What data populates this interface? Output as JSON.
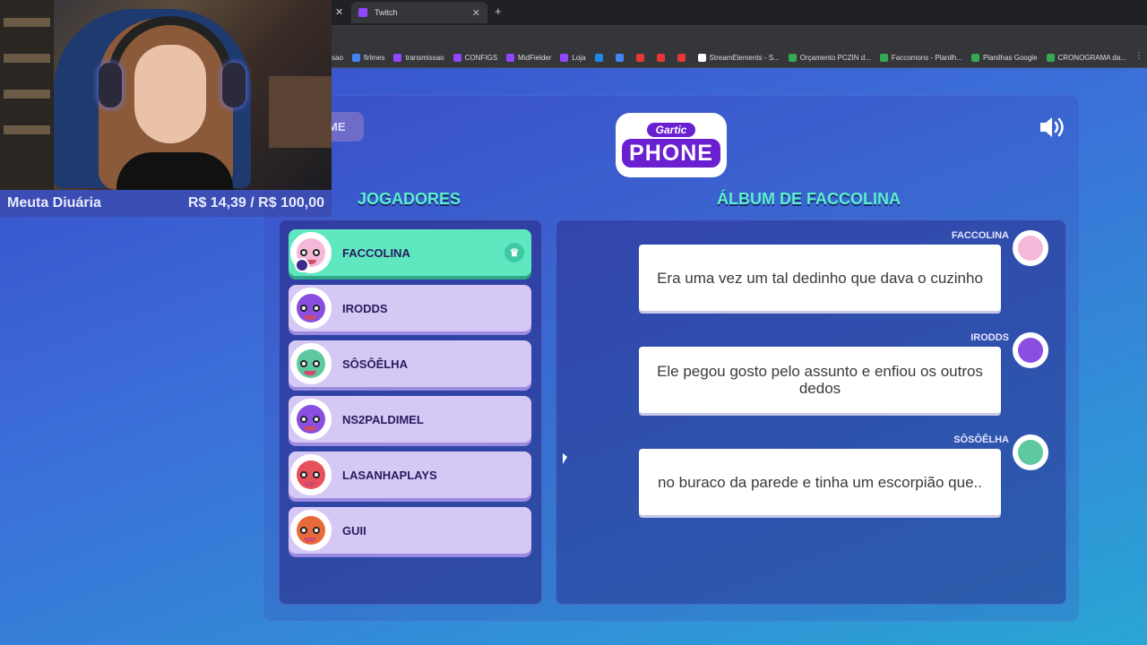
{
  "browser": {
    "active_tab": "Twitch",
    "bookmarks": [
      {
        "label": "sao",
        "color": ""
      },
      {
        "label": "firlmes",
        "color": "#4285f4"
      },
      {
        "label": "transmissao",
        "color": "#9146ff"
      },
      {
        "label": "CONFIGS",
        "color": "#9146ff"
      },
      {
        "label": "MidFielder",
        "color": "#9146ff"
      },
      {
        "label": "Loja",
        "color": "#9146ff"
      },
      {
        "label": "",
        "color": "#1e88e5"
      },
      {
        "label": "",
        "color": "#4285f4"
      },
      {
        "label": "",
        "color": "#e53935"
      },
      {
        "label": "",
        "color": "#e53935"
      },
      {
        "label": "",
        "color": "#e53935"
      },
      {
        "label": "StreamElements - S...",
        "color": "#ffffff"
      },
      {
        "label": "Orçamento PCZIN d...",
        "color": "#34a853"
      },
      {
        "label": "Faccomons - Planilh...",
        "color": "#34a853"
      },
      {
        "label": "Planilhas Google",
        "color": "#34a853"
      },
      {
        "label": "CRONOGRAMA da...",
        "color": "#34a853"
      }
    ]
  },
  "stream": {
    "goal_name": "Meuta Diuária",
    "goal_progress": "R$ 14,39 / R$ 100,00"
  },
  "game": {
    "home_label": "ME",
    "logo_top": "Gartic",
    "logo_bottom": "PHONE",
    "players_title": "JOGADORES",
    "album_title": "ÁLBUM DE FACCOLINA",
    "players": [
      {
        "name": "FACCOLINA",
        "host": true,
        "color": "#f6b8d8"
      },
      {
        "name": "IRODDS",
        "host": false,
        "color": "#8a4fe0"
      },
      {
        "name": "SÔSÔÊLHA",
        "host": false,
        "color": "#5ec8a0"
      },
      {
        "name": "NS2PALDIMEL",
        "host": false,
        "color": "#8a4fe0"
      },
      {
        "name": "LASANHAPLAYS",
        "host": false,
        "color": "#e8505b"
      },
      {
        "name": "GUII",
        "host": false,
        "color": "#e86a3a"
      }
    ],
    "album": [
      {
        "author": "FACCOLINA",
        "text": "Era uma vez um tal dedinho que dava o cuzinho",
        "color": "#f6b8d8"
      },
      {
        "author": "IRODDS",
        "text": "Ele pegou gosto pelo assunto e enfiou os outros dedos",
        "color": "#8a4fe0"
      },
      {
        "author": "SÔSÔÊLHA",
        "text": "no buraco da parede e tinha um escorpião que..",
        "color": "#5ec8a0"
      }
    ]
  },
  "colors": {
    "accent_title": "#5bf0d0",
    "host_row": "#5fe8c0",
    "player_row": "#d6c8f5"
  }
}
